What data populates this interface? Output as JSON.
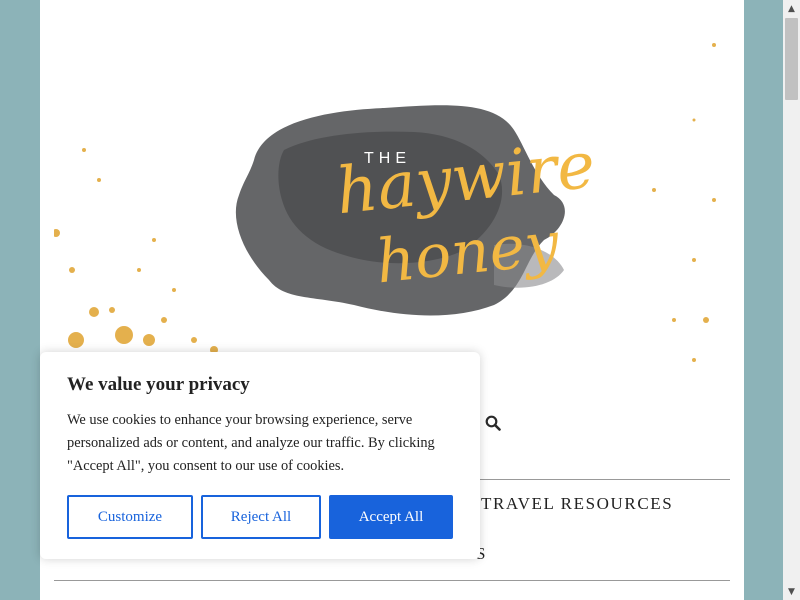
{
  "logo": {
    "the": "THE",
    "word1": "haywire",
    "word2": "honey",
    "colors": {
      "ink": "#58595b",
      "gold": "#f2b843"
    }
  },
  "header": {
    "search_icon": "search-icon"
  },
  "nav": {
    "travel_resources": "TRAVEL RESOURCES",
    "partial_item": "S"
  },
  "cookie": {
    "title": "We value your privacy",
    "body": "We use cookies to enhance your browsing experience, serve personalized ads or content, and analyze our traffic. By clicking \"Accept All\", you consent to our use of cookies.",
    "customize_label": "Customize",
    "reject_label": "Reject All",
    "accept_label": "Accept All",
    "accent": "#1863dc"
  },
  "scrollbar": {
    "up_icon": "arrow-up-icon",
    "down_icon": "arrow-down-icon"
  },
  "colors": {
    "background": "#8cb3b8",
    "page": "#ffffff"
  }
}
